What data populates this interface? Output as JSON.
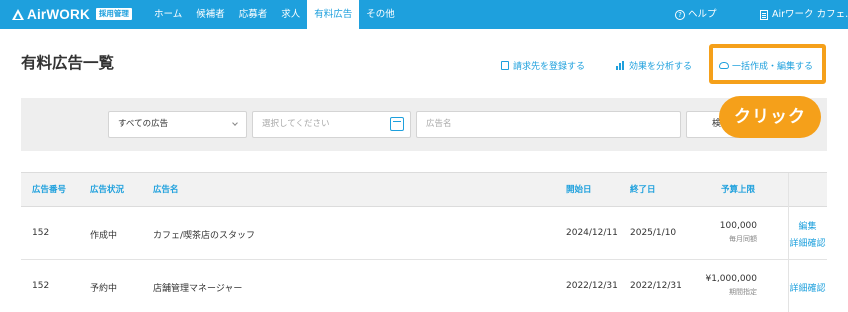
{
  "topbar": {
    "logo_text": "AirWORK",
    "logo_badge": "採用管理",
    "nav": [
      "ホーム",
      "候補者",
      "応募者",
      "求人",
      "有料広告",
      "その他"
    ],
    "active_nav": "有料広告",
    "help_icon": "?",
    "help": "ヘルプ",
    "account": "Airワーク カフェ…",
    "colors": {
      "brand": "#1ea0dd",
      "highlight": "#f5a01a"
    }
  },
  "page": {
    "title": "有料広告一覧",
    "actions": {
      "register_billing": "請求先を登録する",
      "analyze": "効果を分析する",
      "bulk_create": "一括作成・編集する"
    },
    "callout": "クリック"
  },
  "filters": {
    "type_select": "すべての広告",
    "date_placeholder": "選択してください",
    "name_placeholder": "広告名",
    "search_button": "検索"
  },
  "table": {
    "headers": {
      "number": "広告番号",
      "status": "広告状況",
      "name": "広告名",
      "start": "開始日",
      "end": "終了日",
      "budget": "予算上限"
    },
    "rows": [
      {
        "number": "152",
        "status": "作成中",
        "name": "カフェ/喫茶店のスタッフ",
        "start": "2024/12/11",
        "end": "2025/1/10",
        "budget": "100,000",
        "budget_note": "毎月同額",
        "link_edit": "編集",
        "link_detail": "詳細確認"
      },
      {
        "number": "152",
        "status": "予約中",
        "name": "店舗管理マネージャー",
        "start": "2022/12/31",
        "end": "2022/12/31",
        "budget": "¥1,000,000",
        "budget_note": "期間指定",
        "link_detail": "詳細確認"
      }
    ]
  }
}
